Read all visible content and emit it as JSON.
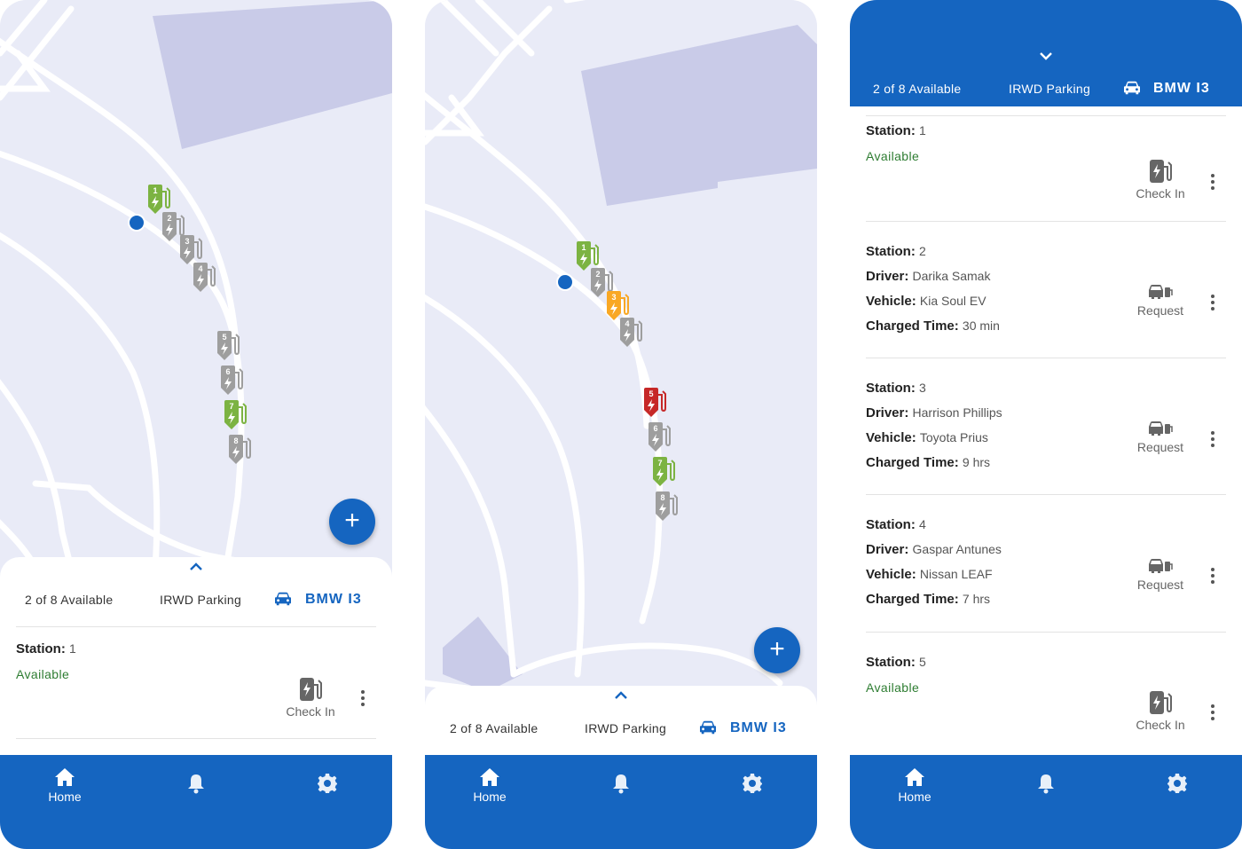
{
  "summary": {
    "availability": "2 of 8 Available",
    "lot": "IRWD Parking",
    "vehicle": "BMW I3"
  },
  "labels": {
    "station": "Station:",
    "driver": "Driver:",
    "vehicle": "Vehicle:",
    "charged_time": "Charged Time:",
    "available": "Available",
    "check_in": "Check In",
    "request": "Request"
  },
  "fab": {
    "icon": "plus-icon",
    "label": "+"
  },
  "nav": {
    "home": "Home",
    "home_icon": "home-icon",
    "alerts_icon": "bell-icon",
    "settings_icon": "gear-icon"
  },
  "map1_markers": [
    "1",
    "2",
    "3",
    "4",
    "5",
    "6",
    "7",
    "8"
  ],
  "map2_markers": [
    "1",
    "2",
    "3",
    "4",
    "5",
    "6",
    "7",
    "8"
  ],
  "stations": [
    {
      "number": "1",
      "status": "Available"
    },
    {
      "number": "2",
      "driver": "Darika Samak",
      "vehicle": "Kia Soul EV",
      "charged_time": "30 min"
    },
    {
      "number": "3",
      "driver": "Harrison Phillips",
      "vehicle": "Toyota Prius",
      "charged_time": "9 hrs"
    },
    {
      "number": "4",
      "driver": "Gaspar Antunes",
      "vehicle": "Nissan LEAF",
      "charged_time": "7 hrs"
    },
    {
      "number": "5",
      "status": "Available"
    }
  ],
  "colors": {
    "brand": "#1565c0",
    "available_green": "#7cb342",
    "occupied_gray": "#9e9e9e",
    "charging_orange": "#f9a825",
    "fault_red": "#c62828",
    "status_text_green": "#2e7d32"
  }
}
